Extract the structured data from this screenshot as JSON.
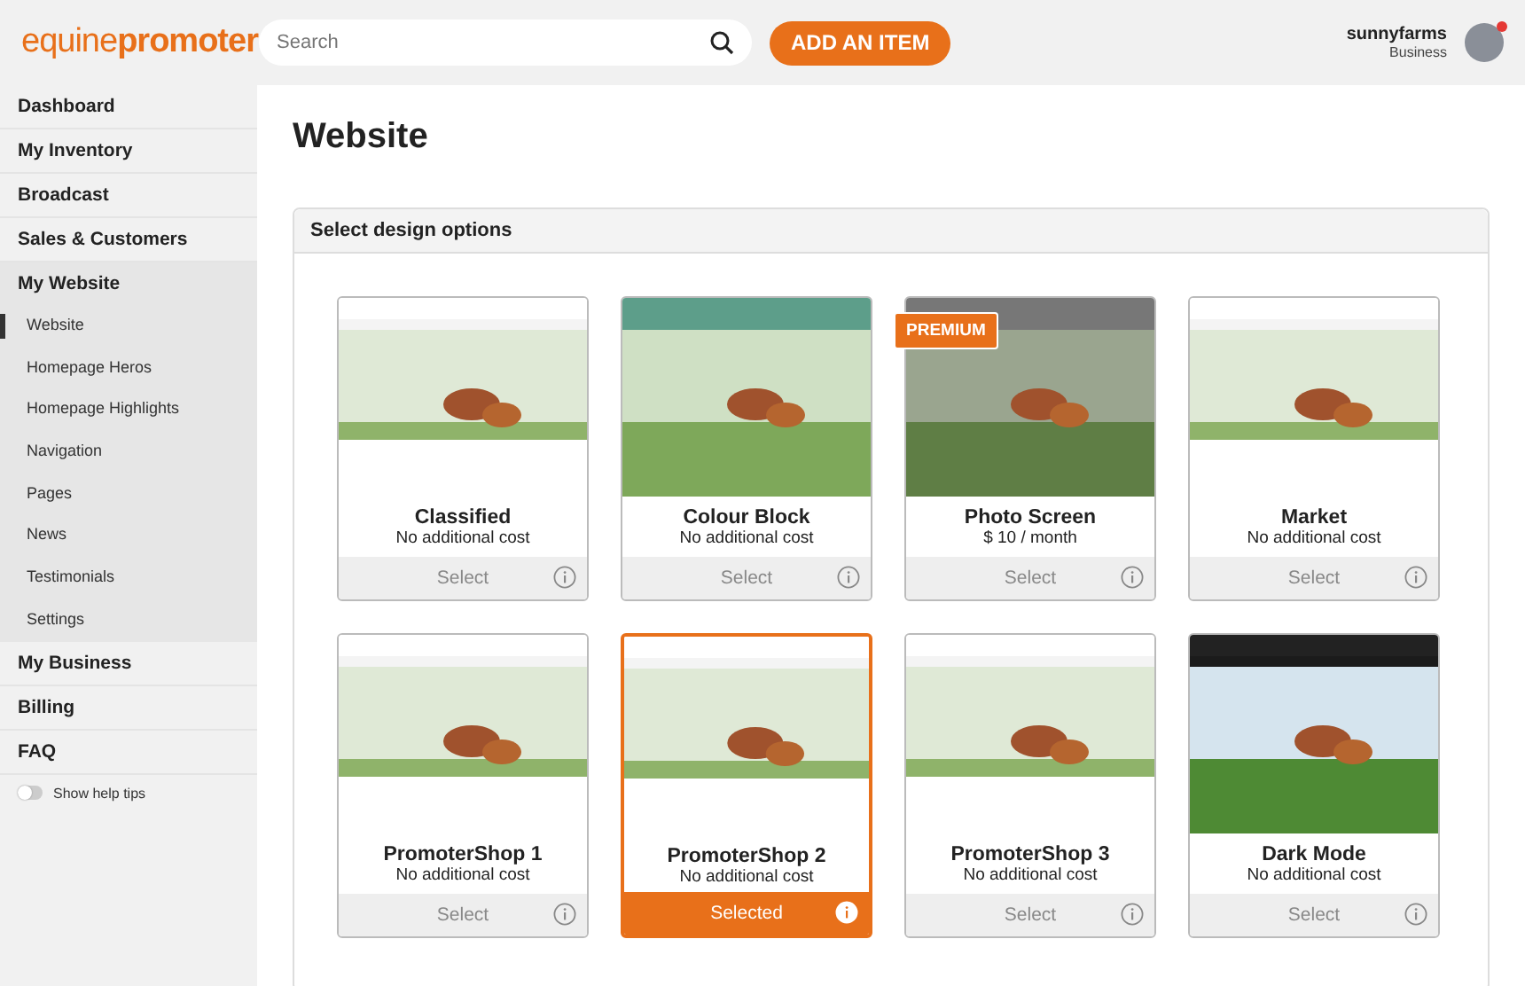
{
  "header": {
    "logo": {
      "part_1": "equine",
      "part_2": "promoter"
    },
    "search": {
      "placeholder": "Search"
    },
    "add_button": "ADD AN ITEM",
    "user": {
      "name": "sunnyfarms",
      "role": "Business",
      "notification": true
    }
  },
  "sidebar": {
    "items": [
      {
        "label": "Dashboard",
        "expanded": false
      },
      {
        "label": "My Inventory",
        "expanded": false
      },
      {
        "label": "Broadcast",
        "expanded": false
      },
      {
        "label": "Sales & Customers",
        "expanded": false
      },
      {
        "label": "My Website",
        "expanded": true,
        "children": [
          {
            "label": "Website",
            "selected": true
          },
          {
            "label": "Homepage Heros",
            "selected": false
          },
          {
            "label": "Homepage Highlights",
            "selected": false
          },
          {
            "label": "Navigation",
            "selected": false
          },
          {
            "label": "Pages",
            "selected": false
          },
          {
            "label": "News",
            "selected": false
          },
          {
            "label": "Testimonials",
            "selected": false
          },
          {
            "label": "Settings",
            "selected": false
          }
        ]
      },
      {
        "label": "My Business",
        "expanded": false
      },
      {
        "label": "Billing",
        "expanded": false
      },
      {
        "label": "FAQ",
        "expanded": false
      }
    ],
    "help_toggle": {
      "label": "Show help tips",
      "on": false
    }
  },
  "page": {
    "title": "Website",
    "panel_title": "Select design options",
    "designs": [
      {
        "name": "Classified",
        "cost": "No additional cost",
        "button": "Select",
        "selected": false
      },
      {
        "name": "Colour Block",
        "cost": "No additional cost",
        "button": "Select",
        "selected": false
      },
      {
        "name": "Photo Screen",
        "cost": "$ 10 / month",
        "button": "Select",
        "selected": false,
        "badge": "PREMIUM"
      },
      {
        "name": "Market",
        "cost": "No additional cost",
        "button": "Select",
        "selected": false
      },
      {
        "name": "PromoterShop 1",
        "cost": "No additional cost",
        "button": "Select",
        "selected": false
      },
      {
        "name": "PromoterShop 2",
        "cost": "No additional cost",
        "button": "Selected",
        "selected": true
      },
      {
        "name": "PromoterShop 3",
        "cost": "No additional cost",
        "button": "Select",
        "selected": false
      },
      {
        "name": "Dark Mode",
        "cost": "No additional cost",
        "button": "Select",
        "selected": false
      }
    ]
  }
}
